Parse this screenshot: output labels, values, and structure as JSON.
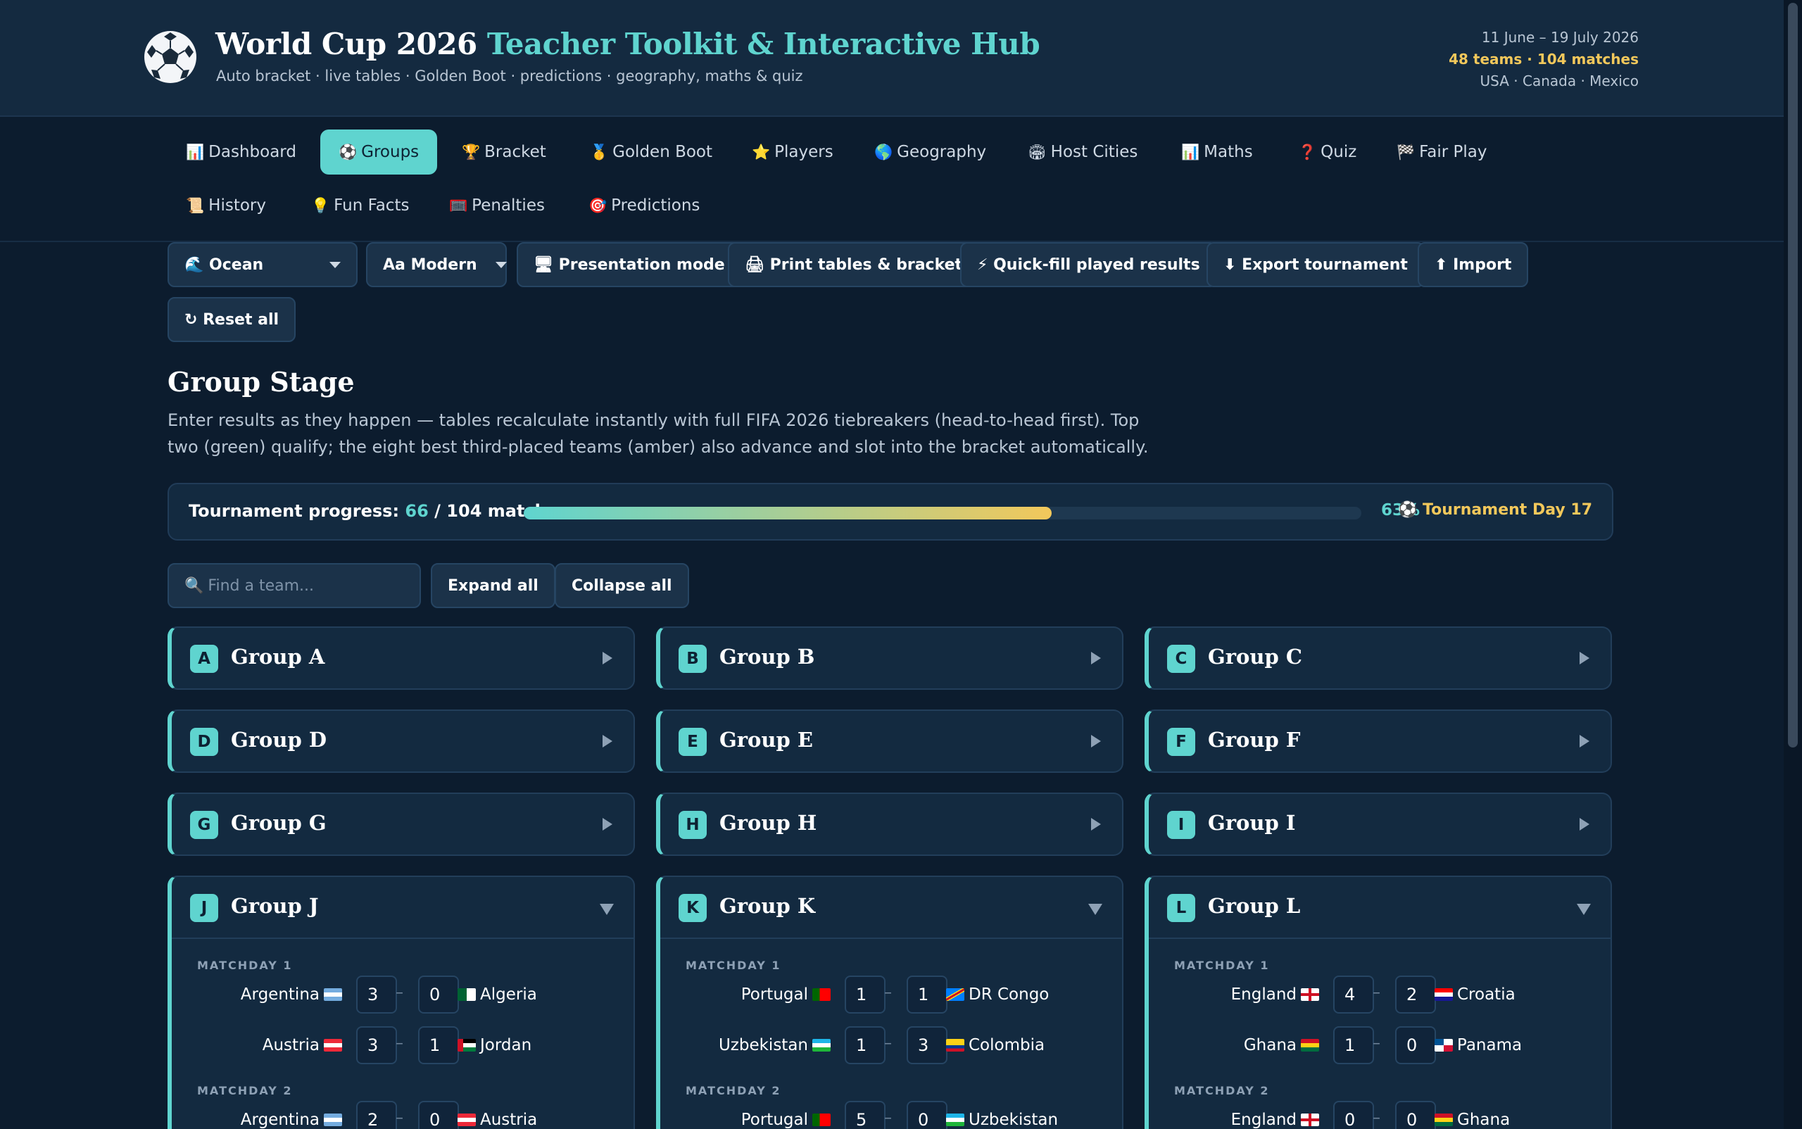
{
  "header": {
    "title_main": "World Cup 2026",
    "title_accent": "Teacher Toolkit & Interactive Hub",
    "subtitle": "Auto bracket · live tables · Golden Boot · predictions · geography, maths & quiz",
    "dates": "11 June – 19 July 2026",
    "stats": "48 teams · 104 matches",
    "hosts": "USA · Canada · Mexico"
  },
  "nav": [
    {
      "icon": "📊",
      "label": "Dashboard"
    },
    {
      "icon": "⚽",
      "label": "Groups"
    },
    {
      "icon": "🏆",
      "label": "Bracket"
    },
    {
      "icon": "🥇",
      "label": "Golden Boot"
    },
    {
      "icon": "⭐",
      "label": "Players"
    },
    {
      "icon": "🌎",
      "label": "Geography"
    },
    {
      "icon": "🏟",
      "label": "Host Cities"
    },
    {
      "icon": "📊",
      "label": "Maths"
    },
    {
      "icon": "❓",
      "label": "Quiz"
    },
    {
      "icon": "🏁",
      "label": "Fair Play"
    },
    {
      "icon": "📜",
      "label": "History"
    },
    {
      "icon": "💡",
      "label": "Fun Facts"
    },
    {
      "icon": "🥅",
      "label": "Penalties"
    },
    {
      "icon": "🎯",
      "label": "Predictions"
    }
  ],
  "nav_active": "Groups",
  "toolbar": {
    "theme": "🌊 Ocean",
    "font": "Aa Modern",
    "presentation": "🖥 Presentation mode",
    "print": "🖨 Print tables & bracket",
    "quickfill": "⚡ Quick-fill played results",
    "export": "⬇ Export tournament",
    "import": "⬆ Import",
    "reset": "↻ Reset all"
  },
  "section": {
    "title": "Group Stage",
    "description": "Enter results as they happen — tables recalculate instantly with full FIFA 2026 tiebreakers (head-to-head first). Top two (green) qualify; the eight best third-placed teams (amber) also advance and slot into the bracket automatically."
  },
  "progress": {
    "label": "Tournament progress:",
    "played": "66",
    "total": "/ 104 matches",
    "fraction": 0.63,
    "percent": "63%",
    "day": "⚽ Tournament Day 17"
  },
  "controls": {
    "search_icon": "🔍",
    "search_placeholder": "Find a team...",
    "expand": "Expand all",
    "collapse": "Collapse all"
  },
  "groups_collapsed": [
    {
      "letter": "A",
      "name": "Group A"
    },
    {
      "letter": "B",
      "name": "Group B"
    },
    {
      "letter": "C",
      "name": "Group C"
    },
    {
      "letter": "D",
      "name": "Group D"
    },
    {
      "letter": "E",
      "name": "Group E"
    },
    {
      "letter": "F",
      "name": "Group F"
    },
    {
      "letter": "G",
      "name": "Group G"
    },
    {
      "letter": "H",
      "name": "Group H"
    },
    {
      "letter": "I",
      "name": "Group I"
    }
  ],
  "groups_open": [
    {
      "letter": "J",
      "name": "Group J",
      "md1": "MATCHDAY 1",
      "matches": [
        {
          "home": "Argentina",
          "hs": "3",
          "as": "0",
          "away": "Algeria"
        },
        {
          "home": "Austria",
          "hs": "3",
          "as": "1",
          "away": "Jordan"
        }
      ],
      "md2": "MATCHDAY 2",
      "md2_first": {
        "home": "Argentina",
        "hs": "2",
        "as": "0",
        "away": "Austria"
      }
    },
    {
      "letter": "K",
      "name": "Group K",
      "md1": "MATCHDAY 1",
      "matches": [
        {
          "home": "Portugal",
          "hs": "1",
          "as": "1",
          "away": "DR Congo"
        },
        {
          "home": "Uzbekistan",
          "hs": "1",
          "as": "3",
          "away": "Colombia"
        }
      ],
      "md2": "MATCHDAY 2",
      "md2_first": {
        "home": "Portugal",
        "hs": "5",
        "as": "0",
        "away": "Uzbekistan"
      }
    },
    {
      "letter": "L",
      "name": "Group L",
      "md1": "MATCHDAY 1",
      "matches": [
        {
          "home": "England",
          "hs": "4",
          "as": "2",
          "away": "Croatia"
        },
        {
          "home": "Ghana",
          "hs": "1",
          "as": "0",
          "away": "Panama"
        }
      ],
      "md2": "MATCHDAY 2",
      "md2_first": {
        "home": "England",
        "hs": "0",
        "as": "0",
        "away": "Ghana"
      }
    }
  ],
  "colors": {
    "accent": "#5fd4cf",
    "gold": "#f2c85b",
    "background": "#0c1c2e",
    "panel": "#132a40"
  }
}
